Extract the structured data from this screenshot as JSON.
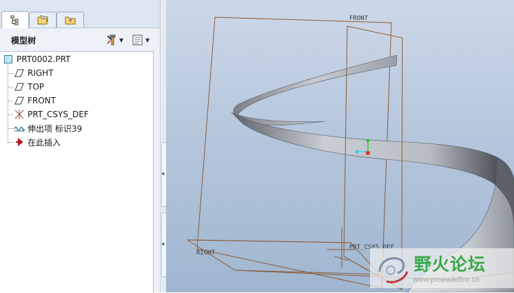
{
  "panel": {
    "tabs": [
      {
        "icon": "model-tree-icon",
        "active": true
      },
      {
        "icon": "folder-browser-icon",
        "active": false
      },
      {
        "icon": "favorites-icon",
        "active": false
      }
    ],
    "title": "模型树",
    "tools_icon": "tools-icon",
    "settings_icon": "settings-icon"
  },
  "tree": {
    "root": {
      "label": "PRT0002.PRT",
      "icon": "part-icon"
    },
    "items": [
      {
        "label": "RIGHT",
        "icon": "datum-plane-icon"
      },
      {
        "label": "TOP",
        "icon": "datum-plane-icon"
      },
      {
        "label": "FRONT",
        "icon": "datum-plane-icon"
      },
      {
        "label": "PRT_CSYS_DEF",
        "icon": "csys-icon"
      },
      {
        "label": "伸出项 标识39",
        "icon": "protrusion-icon"
      },
      {
        "label": "在此插入",
        "icon": "insert-here-arrow-icon"
      }
    ]
  },
  "viewport": {
    "labels": {
      "front": "FRONT",
      "right": "RIGHT",
      "csys": "PRT_CSYS_DEF"
    },
    "colors": {
      "datum": "#8a5a35",
      "surface_light": "#d8dde3",
      "surface_dark": "#5e636a"
    }
  },
  "watermark": {
    "title": "野火论坛",
    "url": "www.proewildfire.cn"
  }
}
